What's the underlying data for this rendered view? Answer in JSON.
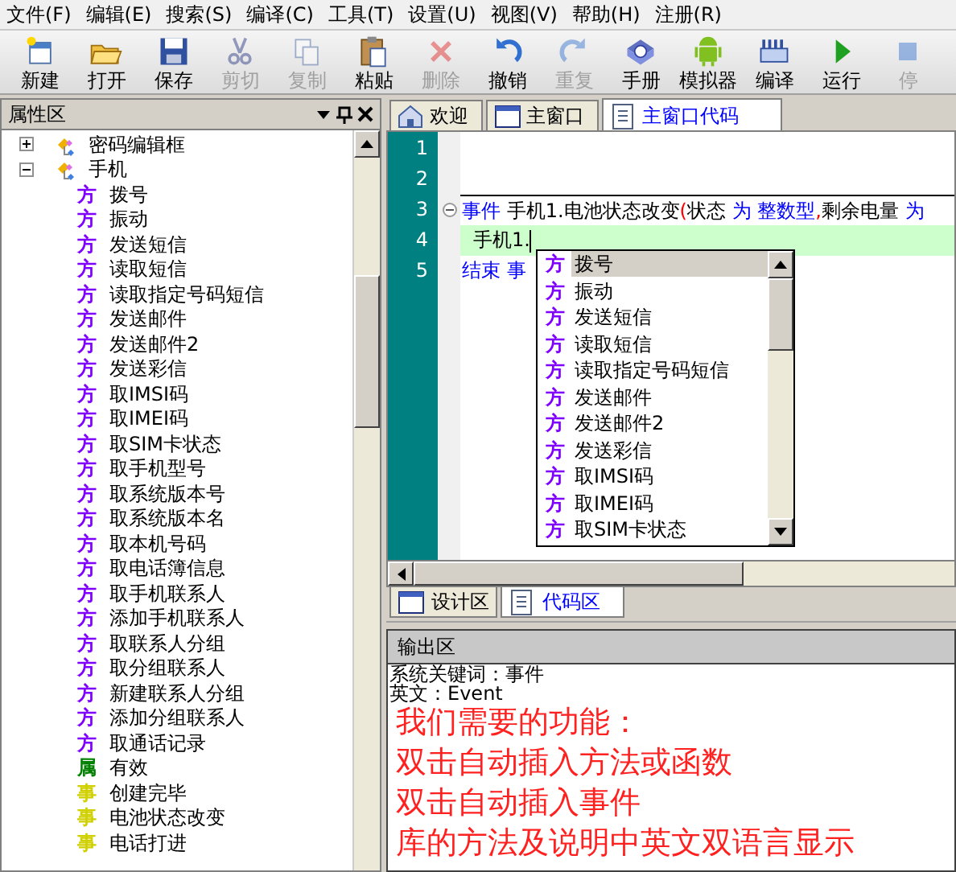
{
  "menu": [
    "文件(F)",
    "编辑(E)",
    "搜索(S)",
    "编译(C)",
    "工具(T)",
    "设置(U)",
    "视图(V)",
    "帮助(H)",
    "注册(R)"
  ],
  "toolbar": [
    {
      "label": "新建",
      "kind": "new",
      "disabled": false
    },
    {
      "label": "打开",
      "kind": "open",
      "disabled": false
    },
    {
      "label": "保存",
      "kind": "save",
      "disabled": false
    },
    {
      "label": "剪切",
      "kind": "cut",
      "disabled": true
    },
    {
      "label": "复制",
      "kind": "copy",
      "disabled": true
    },
    {
      "label": "粘贴",
      "kind": "paste",
      "disabled": false
    },
    {
      "label": "删除",
      "kind": "delete",
      "disabled": true
    },
    {
      "label": "撤销",
      "kind": "undo",
      "disabled": false
    },
    {
      "label": "重复",
      "kind": "redo",
      "disabled": true
    },
    {
      "label": "手册",
      "kind": "help",
      "disabled": false
    },
    {
      "label": "模拟器",
      "kind": "android",
      "disabled": false
    },
    {
      "label": "编译",
      "kind": "build",
      "disabled": false
    },
    {
      "label": "运行",
      "kind": "run",
      "disabled": false
    },
    {
      "label": "停",
      "kind": "stop",
      "disabled": true
    }
  ],
  "property_panel": {
    "title": "属性区",
    "tree": [
      {
        "label": "密码编辑框",
        "expanded": false
      },
      {
        "label": "手机",
        "expanded": true,
        "children": [
          {
            "badge": "方",
            "kind": "method",
            "label": "拨号"
          },
          {
            "badge": "方",
            "kind": "method",
            "label": "振动"
          },
          {
            "badge": "方",
            "kind": "method",
            "label": "发送短信"
          },
          {
            "badge": "方",
            "kind": "method",
            "label": "读取短信"
          },
          {
            "badge": "方",
            "kind": "method",
            "label": "读取指定号码短信"
          },
          {
            "badge": "方",
            "kind": "method",
            "label": "发送邮件"
          },
          {
            "badge": "方",
            "kind": "method",
            "label": "发送邮件2"
          },
          {
            "badge": "方",
            "kind": "method",
            "label": "发送彩信"
          },
          {
            "badge": "方",
            "kind": "method",
            "label": "取IMSI码"
          },
          {
            "badge": "方",
            "kind": "method",
            "label": "取IMEI码"
          },
          {
            "badge": "方",
            "kind": "method",
            "label": "取SIM卡状态"
          },
          {
            "badge": "方",
            "kind": "method",
            "label": "取手机型号"
          },
          {
            "badge": "方",
            "kind": "method",
            "label": "取系统版本号"
          },
          {
            "badge": "方",
            "kind": "method",
            "label": "取系统版本名"
          },
          {
            "badge": "方",
            "kind": "method",
            "label": "取本机号码"
          },
          {
            "badge": "方",
            "kind": "method",
            "label": "取电话簿信息"
          },
          {
            "badge": "方",
            "kind": "method",
            "label": "取手机联系人"
          },
          {
            "badge": "方",
            "kind": "method",
            "label": "添加手机联系人"
          },
          {
            "badge": "方",
            "kind": "method",
            "label": "取联系人分组"
          },
          {
            "badge": "方",
            "kind": "method",
            "label": "取分组联系人"
          },
          {
            "badge": "方",
            "kind": "method",
            "label": "新建联系人分组"
          },
          {
            "badge": "方",
            "kind": "method",
            "label": "添加分组联系人"
          },
          {
            "badge": "方",
            "kind": "method",
            "label": "取通话记录"
          },
          {
            "badge": "属",
            "kind": "property",
            "label": "有效"
          },
          {
            "badge": "事",
            "kind": "event",
            "label": "创建完毕"
          },
          {
            "badge": "事",
            "kind": "event",
            "label": "电池状态改变"
          },
          {
            "badge": "事",
            "kind": "event",
            "label": "电话打进"
          }
        ]
      }
    ]
  },
  "editor_tabs": [
    {
      "label": "欢迎",
      "kind": "home",
      "selected": false
    },
    {
      "label": "主窗口",
      "kind": "window",
      "selected": false
    },
    {
      "label": "主窗口代码",
      "kind": "code",
      "selected": true
    }
  ],
  "code_lines": [
    {
      "number": "1"
    },
    {
      "number": "2"
    },
    {
      "number": "3",
      "fold": true,
      "tokens": [
        {
          "text": "事件",
          "kind": "keyword"
        },
        {
          "text": " 手机1.电池状态改变",
          "kind": "plain"
        },
        {
          "text": "(",
          "kind": "mark"
        },
        {
          "text": "状态 ",
          "kind": "plain"
        },
        {
          "text": "为",
          "kind": "keyword"
        },
        {
          "text": " 整数型",
          "kind": "keyword"
        },
        {
          "text": ",",
          "kind": "mark"
        },
        {
          "text": "剩余电量 ",
          "kind": "plain"
        },
        {
          "text": "为",
          "kind": "keyword"
        }
      ]
    },
    {
      "number": "4",
      "current": true,
      "tokens": [
        {
          "text": "手机1.",
          "kind": "plain"
        }
      ]
    },
    {
      "number": "5",
      "tokens": [
        {
          "text": "结束 事",
          "kind": "keyword"
        }
      ]
    }
  ],
  "autocomplete": [
    {
      "badge": "方",
      "label": "拨号",
      "selected": true
    },
    {
      "badge": "方",
      "label": "振动",
      "selected": false
    },
    {
      "badge": "方",
      "label": "发送短信",
      "selected": false
    },
    {
      "badge": "方",
      "label": "读取短信",
      "selected": false
    },
    {
      "badge": "方",
      "label": "读取指定号码短信",
      "selected": false
    },
    {
      "badge": "方",
      "label": "发送邮件",
      "selected": false
    },
    {
      "badge": "方",
      "label": "发送邮件2",
      "selected": false
    },
    {
      "badge": "方",
      "label": "发送彩信",
      "selected": false
    },
    {
      "badge": "方",
      "label": "取IMSI码",
      "selected": false
    },
    {
      "badge": "方",
      "label": "取IMEI码",
      "selected": false
    },
    {
      "badge": "方",
      "label": "取SIM卡状态",
      "selected": false
    }
  ],
  "view_tabs": [
    {
      "label": "设计区",
      "kind": "window",
      "selected": false
    },
    {
      "label": "代码区",
      "kind": "code",
      "selected": true
    }
  ],
  "output": {
    "title": "输出区",
    "lines": [
      {
        "text": "系统关键词：事件",
        "kind": "info"
      },
      {
        "text": "英文：Event",
        "kind": "info"
      },
      {
        "text": "我们需要的功能：",
        "kind": "note"
      },
      {
        "text": "双击自动插入方法或函数",
        "kind": "note"
      },
      {
        "text": "双击自动插入事件",
        "kind": "note"
      },
      {
        "text": "库的方法及说明中英文双语言显示",
        "kind": "note"
      }
    ]
  }
}
